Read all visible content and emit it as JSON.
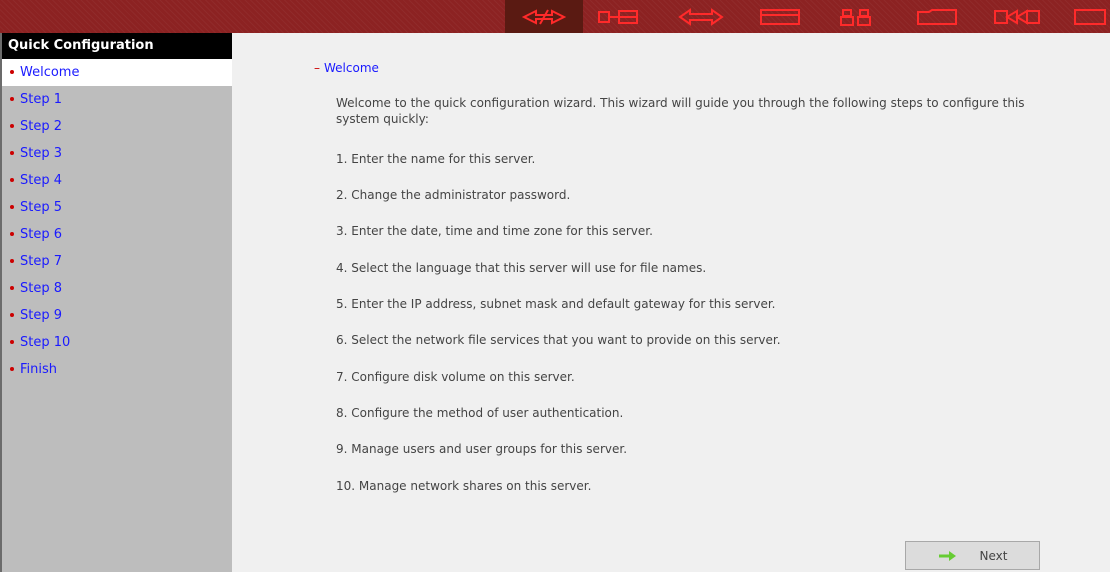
{
  "toolbar": {
    "icons": [
      "wizard-icon",
      "network-icon",
      "arrows-icon",
      "window-icon",
      "users-icon",
      "folder-icon",
      "connection-icon",
      "disk-icon"
    ]
  },
  "sidebar": {
    "title": "Quick Configuration",
    "items": [
      {
        "label": "Welcome",
        "active": true
      },
      {
        "label": "Step 1"
      },
      {
        "label": "Step 2"
      },
      {
        "label": "Step 3"
      },
      {
        "label": "Step 4"
      },
      {
        "label": "Step 5"
      },
      {
        "label": "Step 6"
      },
      {
        "label": "Step 7"
      },
      {
        "label": "Step 8"
      },
      {
        "label": "Step 9"
      },
      {
        "label": "Step 10"
      },
      {
        "label": "Finish"
      }
    ]
  },
  "main": {
    "section_title": "Welcome",
    "intro": "Welcome to the quick configuration wizard. This wizard will guide you through the following steps to configure this system quickly:",
    "steps": [
      "1. Enter the name for this server.",
      "2. Change the administrator password.",
      "3. Enter the date, time and time zone for this server.",
      "4. Select the language that this server will use for file names.",
      "5. Enter the IP address, subnet mask and default gateway for this server.",
      "6. Select the network file services that you want to provide on this server.",
      "7. Configure disk volume on this server.",
      "8. Configure the method of user authentication.",
      "9. Manage users and user groups for this server.",
      "10. Manage network shares on this server."
    ],
    "next_label": "Next"
  },
  "colors": {
    "toolbar_bg": "#8c2222",
    "toolbar_icon": "#ff2a2a",
    "link": "#1a1aff",
    "bullet": "#cc0000",
    "next_arrow": "#66cc33"
  }
}
